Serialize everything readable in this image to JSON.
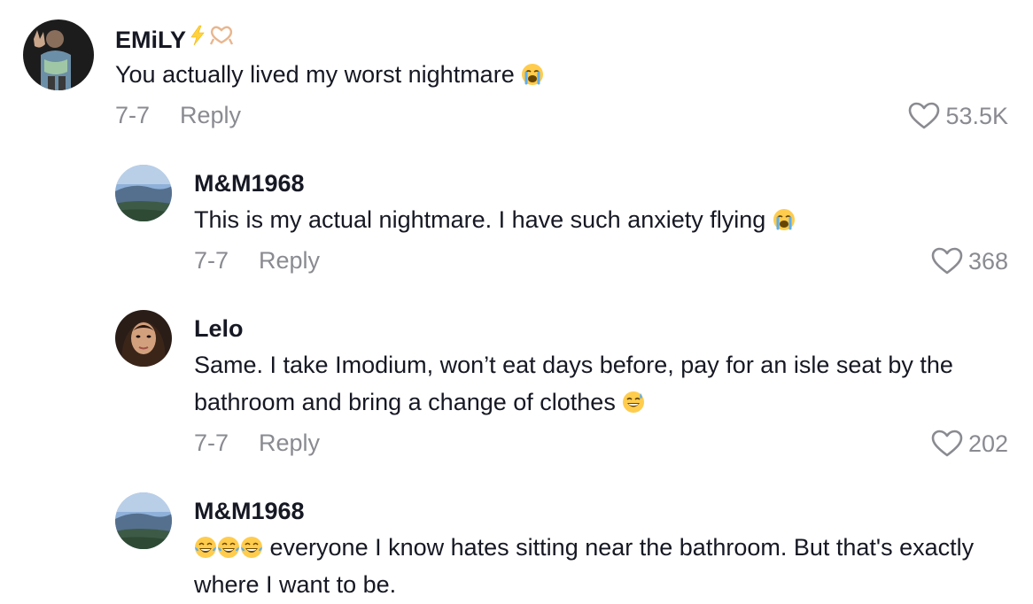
{
  "comments": [
    {
      "username": "EMiLY",
      "text": "You actually lived my worst nightmare",
      "date": "7-7",
      "reply_label": "Reply",
      "likes": "53.5K"
    },
    {
      "username": "M&M1968",
      "text": "This is my actual nightmare. I have such anxiety flying",
      "date": "7-7",
      "reply_label": "Reply",
      "likes": "368"
    },
    {
      "username": "Lelo",
      "text": "Same. I take Imodium, won’t eat days before, pay for an isle seat by the bathroom and bring a change of clothes",
      "date": "7-7",
      "reply_label": "Reply",
      "likes": "202"
    },
    {
      "username": "M&M1968",
      "text": "everyone I know hates sitting near the bathroom. But that's exactly where I want to be.",
      "date": "",
      "reply_label": "",
      "likes": ""
    }
  ],
  "icons": {
    "like": "heart-outline-icon",
    "crying_emoji": "loudly-crying-face-emoji",
    "sweat_smile_emoji": "grinning-face-with-sweat-emoji",
    "laughing_emoji": "face-with-tears-of-joy-emoji",
    "lightning_emoji": "high-voltage-emoji",
    "heart_hands_emoji": "heart-hands-emoji"
  },
  "colors": {
    "text": "#161823",
    "meta": "#8a8b91"
  }
}
